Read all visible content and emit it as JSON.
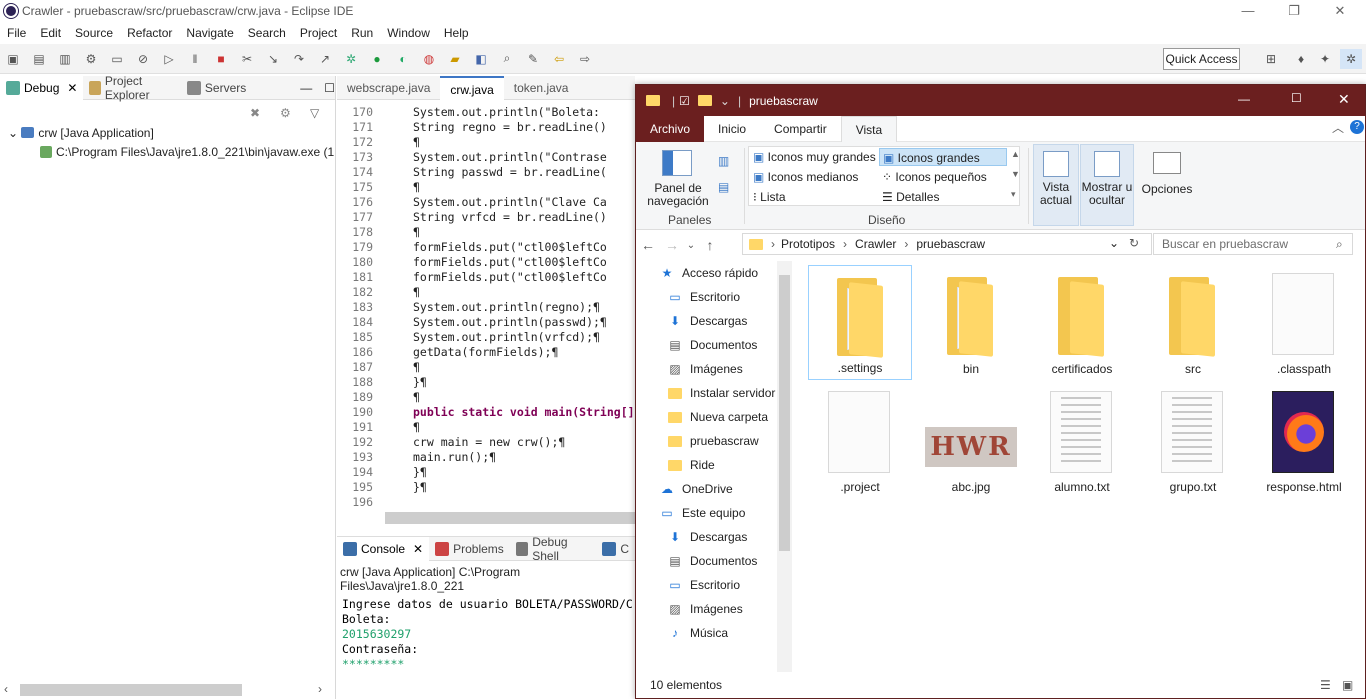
{
  "eclipse": {
    "title": "Crawler - pruebascraw/src/pruebascraw/crw.java - Eclipse IDE",
    "menu": [
      "File",
      "Edit",
      "Source",
      "Refactor",
      "Navigate",
      "Search",
      "Project",
      "Run",
      "Window",
      "Help"
    ],
    "quick_access": "Quick Access",
    "left_tabs": [
      "Debug",
      "Project Explorer",
      "Servers"
    ],
    "debug_tree": {
      "root": "crw [Java Application]",
      "child": "C:\\Program Files\\Java\\jre1.8.0_221\\bin\\javaw.exe (1"
    },
    "editor_tabs": [
      "webscrape.java",
      "crw.java",
      "token.java"
    ],
    "code_lines": [
      {
        "n": "170",
        "t": "System.out.println(\"Boleta:"
      },
      {
        "n": "171",
        "t": "String regno = br.readLine()"
      },
      {
        "n": "172",
        "t": "¶"
      },
      {
        "n": "173",
        "t": "System.out.println(\"Contrase"
      },
      {
        "n": "174",
        "t": "String passwd = br.readLine("
      },
      {
        "n": "175",
        "t": "¶"
      },
      {
        "n": "176",
        "t": "System.out.println(\"Clave Ca"
      },
      {
        "n": "177",
        "t": "String vrfcd = br.readLine()"
      },
      {
        "n": "178",
        "t": "¶"
      },
      {
        "n": "179",
        "t": "formFields.put(\"ctl00$leftCo"
      },
      {
        "n": "180",
        "t": "formFields.put(\"ctl00$leftCo"
      },
      {
        "n": "181",
        "t": "formFields.put(\"ctl00$leftCo"
      },
      {
        "n": "182",
        "t": "¶"
      },
      {
        "n": "183",
        "t": "System.out.println(regno);¶"
      },
      {
        "n": "184",
        "t": "System.out.println(passwd);¶"
      },
      {
        "n": "185",
        "t": "System.out.println(vrfcd);¶"
      },
      {
        "n": "186",
        "t": "getData(formFields);¶"
      },
      {
        "n": "187",
        "t": "¶"
      },
      {
        "n": "188",
        "t": "}¶"
      },
      {
        "n": "189",
        "t": "¶"
      },
      {
        "n": "190",
        "t": "public static void main(String[]"
      },
      {
        "n": "191",
        "t": "¶"
      },
      {
        "n": "192",
        "t": "crw main = new crw();¶"
      },
      {
        "n": "193",
        "t": "main.run();¶"
      },
      {
        "n": "194",
        "t": "}¶"
      },
      {
        "n": "195",
        "t": "}¶"
      },
      {
        "n": "196",
        "t": ""
      }
    ],
    "console_tabs": [
      "Console",
      "Problems",
      "Debug Shell",
      "C"
    ],
    "console_header": "crw [Java Application] C:\\Program Files\\Java\\jre1.8.0_221",
    "console_lines": [
      {
        "t": "Ingrese datos de usuario BOLETA/PASSWORD/C",
        "c": "#000"
      },
      {
        "t": "Boleta:",
        "c": "#000"
      },
      {
        "t": "2015630297",
        "c": "#1fa06b"
      },
      {
        "t": "Contraseña:",
        "c": "#000"
      },
      {
        "t": "*********",
        "c": "#1fa06b"
      }
    ]
  },
  "explorer": {
    "title": "pruebascraw",
    "ribbon_tabs": [
      "Archivo",
      "Inicio",
      "Compartir",
      "Vista"
    ],
    "ribbon": {
      "nav_pane": "Panel de navegación",
      "panels_group": "Paneles",
      "layout_options": [
        "Iconos muy grandes",
        "Iconos grandes",
        "Iconos medianos",
        "Iconos pequeños",
        "Lista",
        "Detalles"
      ],
      "layout_group": "Diseño",
      "current_view": "Vista actual",
      "show_hide": "Mostrar u ocultar",
      "options": "Opciones"
    },
    "path": [
      "Prototipos",
      "Crawler",
      "pruebascraw"
    ],
    "search_placeholder": "Buscar en pruebascraw",
    "nav": [
      {
        "label": "Acceso rápido",
        "icon": "star",
        "pin": false,
        "indent": 0
      },
      {
        "label": "Escritorio",
        "icon": "desktop",
        "pin": true,
        "indent": 1
      },
      {
        "label": "Descargas",
        "icon": "download",
        "pin": true,
        "indent": 1
      },
      {
        "label": "Documentos",
        "icon": "doc",
        "pin": true,
        "indent": 1
      },
      {
        "label": "Imágenes",
        "icon": "img",
        "pin": true,
        "indent": 1
      },
      {
        "label": "Instalar servidor",
        "icon": "folder",
        "pin": false,
        "indent": 1
      },
      {
        "label": "Nueva carpeta",
        "icon": "folder",
        "pin": false,
        "indent": 1
      },
      {
        "label": "pruebascraw",
        "icon": "folder",
        "pin": false,
        "indent": 1
      },
      {
        "label": "Ride",
        "icon": "folder",
        "pin": false,
        "indent": 1
      },
      {
        "label": "OneDrive",
        "icon": "cloud",
        "pin": false,
        "indent": 0
      },
      {
        "label": "Este equipo",
        "icon": "pc",
        "pin": false,
        "indent": 0
      },
      {
        "label": "Descargas",
        "icon": "download",
        "pin": false,
        "indent": 1
      },
      {
        "label": "Documentos",
        "icon": "doc",
        "pin": false,
        "indent": 1
      },
      {
        "label": "Escritorio",
        "icon": "desktop",
        "pin": false,
        "indent": 1
      },
      {
        "label": "Imágenes",
        "icon": "img",
        "pin": false,
        "indent": 1
      },
      {
        "label": "Música",
        "icon": "music",
        "pin": false,
        "indent": 1
      }
    ],
    "files": [
      {
        "name": ".settings",
        "type": "folder-doc"
      },
      {
        "name": "bin",
        "type": "folder-doc"
      },
      {
        "name": "certificados",
        "type": "folder"
      },
      {
        "name": "src",
        "type": "folder"
      },
      {
        "name": ".classpath",
        "type": "blank"
      },
      {
        "name": ".project",
        "type": "blank"
      },
      {
        "name": "abc.jpg",
        "type": "image",
        "caption": "HWR"
      },
      {
        "name": "alumno.txt",
        "type": "text"
      },
      {
        "name": "grupo.txt",
        "type": "text"
      },
      {
        "name": "response.html",
        "type": "firefox"
      }
    ],
    "status": "10 elementos"
  }
}
